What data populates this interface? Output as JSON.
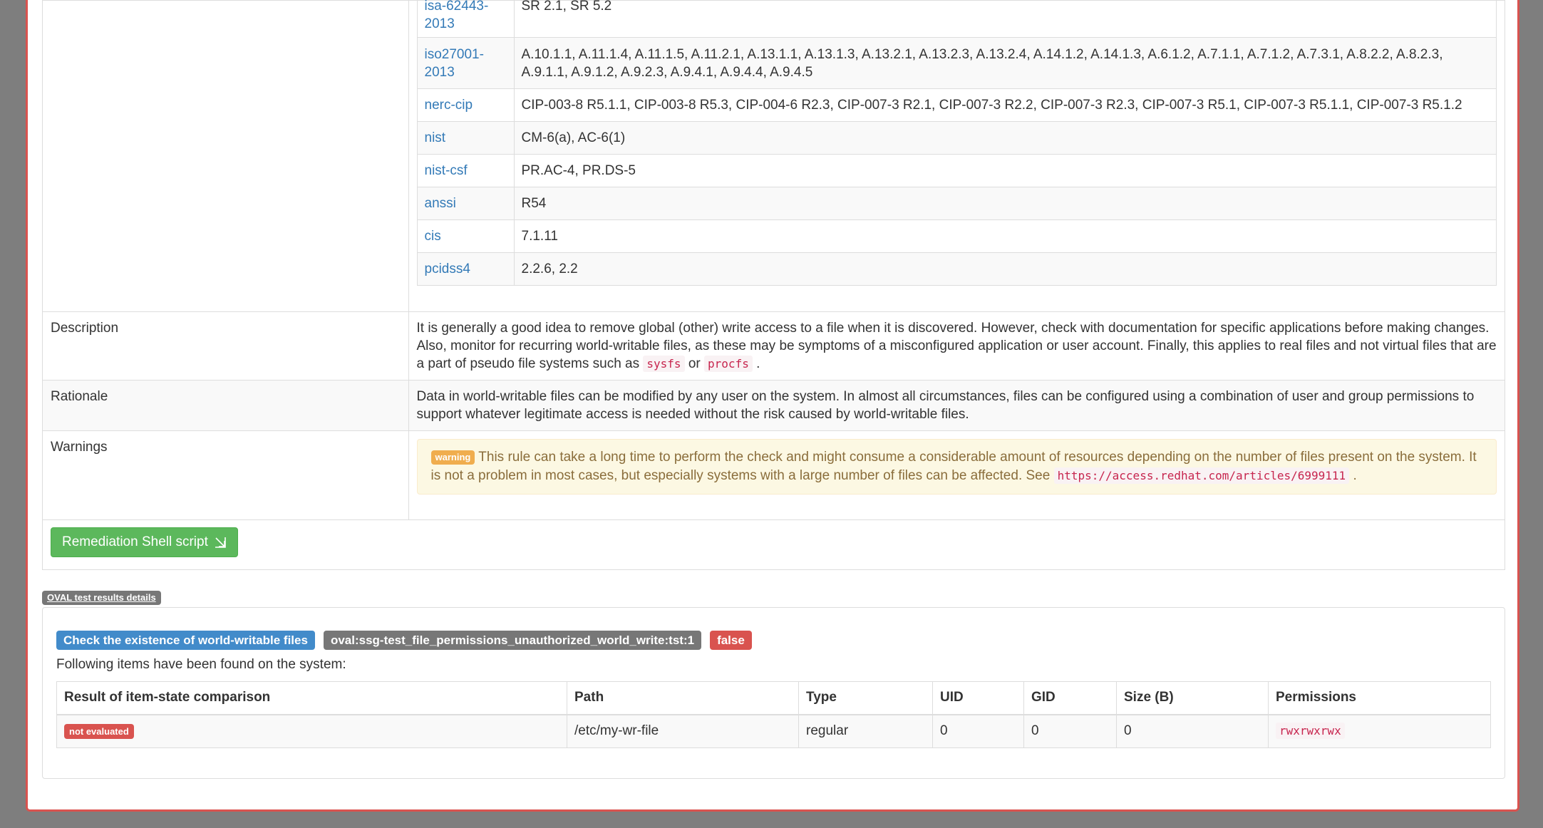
{
  "references": [
    {
      "name": "isa-62443-2013",
      "value": "SR 2.1, SR 5.2"
    },
    {
      "name": "iso27001-2013",
      "value": "A.10.1.1, A.11.1.4, A.11.1.5, A.11.2.1, A.13.1.1, A.13.1.3, A.13.2.1, A.13.2.3, A.13.2.4, A.14.1.2, A.14.1.3, A.6.1.2, A.7.1.1, A.7.1.2, A.7.3.1, A.8.2.2, A.8.2.3, A.9.1.1, A.9.1.2, A.9.2.3, A.9.4.1, A.9.4.4, A.9.4.5"
    },
    {
      "name": "nerc-cip",
      "value": "CIP-003-8 R5.1.1, CIP-003-8 R5.3, CIP-004-6 R2.3, CIP-007-3 R2.1, CIP-007-3 R2.2, CIP-007-3 R2.3, CIP-007-3 R5.1, CIP-007-3 R5.1.1, CIP-007-3 R5.1.2"
    },
    {
      "name": "nist",
      "value": "CM-6(a), AC-6(1)"
    },
    {
      "name": "nist-csf",
      "value": "PR.AC-4, PR.DS-5"
    },
    {
      "name": "anssi",
      "value": "R54"
    },
    {
      "name": "cis",
      "value": "7.1.11"
    },
    {
      "name": "pcidss4",
      "value": "2.2.6, 2.2"
    }
  ],
  "description": {
    "label": "Description",
    "text_before": "It is generally a good idea to remove global (other) write access to a file when it is discovered. However, check with documentation for specific applications before making changes. Also, monitor for recurring world-writable files, as these may be symptoms of a misconfigured application or user account. Finally, this applies to real files and not virtual files that are a part of pseudo file systems such as",
    "code1": "sysfs",
    "text_mid": "or",
    "code2": "procfs",
    "text_after": "."
  },
  "rationale": {
    "label": "Rationale",
    "text": "Data in world-writable files can be modified by any user on the system. In almost all circumstances, files can be configured using a combination of user and group permissions to support whatever legitimate access is needed without the risk caused by world-writable files."
  },
  "warnings": {
    "label": "Warnings",
    "badge": "warning",
    "text": "This rule can take a long time to perform the check and might consume a considerable amount of resources depending on the number of files present on the system. It is not a problem in most cases, but especially systems with a large number of files can be affected. See",
    "url": "https://access.redhat.com/articles/6999111",
    "text_after": "."
  },
  "remediation": {
    "button_label": "Remediation Shell script",
    "icon": "expand-arrow-icon"
  },
  "oval": {
    "badge": "OVAL test results details",
    "check_title": "Check the existence of world-writable files",
    "test_id": "oval:ssg-test_file_permissions_unauthorized_world_write:tst:1",
    "result": "false",
    "following_text": "Following items have been found on the system:",
    "columns": [
      "Result of item-state comparison",
      "Path",
      "Type",
      "UID",
      "GID",
      "Size (B)",
      "Permissions"
    ],
    "row": {
      "state": "not evaluated",
      "path": "/etc/my-wr-file",
      "type": "regular",
      "uid": "0",
      "gid": "0",
      "size": "0",
      "permissions": "rwxrwxrwx"
    }
  },
  "colors": {
    "frame_border": "#d9534f",
    "link": "#337ab7",
    "success": "#5cb85c",
    "primary_label": "#428bca",
    "default_label": "#777777",
    "danger_label": "#d9534f",
    "warning_bg": "#fcf8e3",
    "warning_text": "#8a6d3b",
    "code": "#c7254e"
  }
}
